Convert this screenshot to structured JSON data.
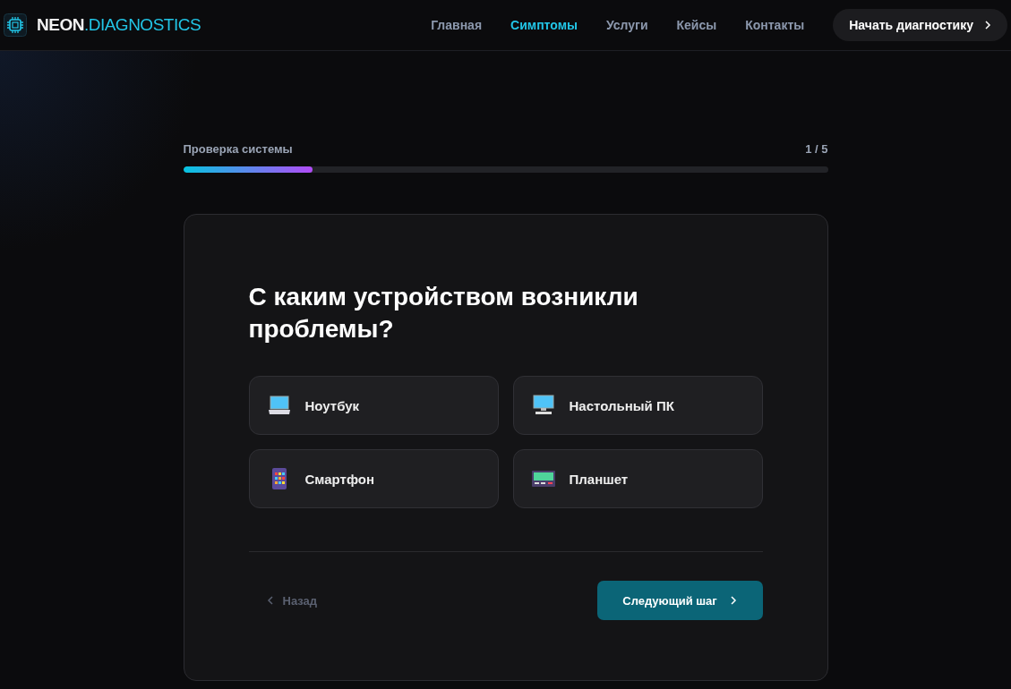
{
  "brand": {
    "name": "NEON",
    "suffix": ".DIAGNOSTICS"
  },
  "nav": [
    {
      "label": "Главная",
      "selected": false
    },
    {
      "label": "Симптомы",
      "selected": true
    },
    {
      "label": "Услуги",
      "selected": false
    },
    {
      "label": "Кейсы",
      "selected": false
    },
    {
      "label": "Контакты",
      "selected": false
    }
  ],
  "cta": {
    "label": "Начать диагностику"
  },
  "progress": {
    "label": "Проверка системы",
    "step": "1 / 5",
    "level": 0.2
  },
  "question": "С каким устройством возникли проблемы?",
  "options": [
    {
      "label": "Ноутбук",
      "kind": "laptop",
      "selected": false
    },
    {
      "label": "Настольный ПК",
      "kind": "desktop",
      "selected": false
    },
    {
      "label": "Смартфон",
      "kind": "phone",
      "selected": false
    },
    {
      "label": "Планшет",
      "kind": "tablet",
      "selected": false
    }
  ],
  "back": {
    "label": "Назад",
    "disabled": true
  },
  "next": {
    "label": "Следующий шаг"
  }
}
